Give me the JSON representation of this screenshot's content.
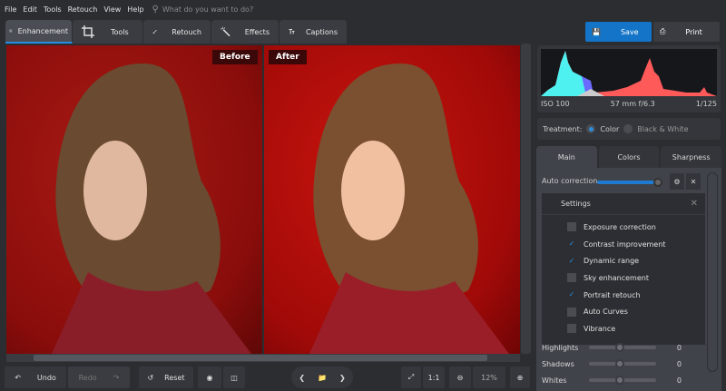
{
  "menu": [
    "File",
    "Edit",
    "Tools",
    "Retouch",
    "View",
    "Help"
  ],
  "search": {
    "placeholder": "What do you want to do?"
  },
  "tabs": [
    {
      "label": "Enhancement",
      "icon": "sliders-icon"
    },
    {
      "label": "Tools",
      "icon": "crop-icon"
    },
    {
      "label": "Retouch",
      "icon": "brush-icon"
    },
    {
      "label": "Effects",
      "icon": "magic-wand-icon"
    },
    {
      "label": "Captions",
      "icon": "text-icon"
    }
  ],
  "actions": {
    "save": "Save",
    "print": "Print"
  },
  "photo": {
    "before": "Before",
    "after": "After"
  },
  "exif": {
    "iso": "ISO 100",
    "lens": "57 mm f/6.3",
    "shutter": "1/125"
  },
  "treatment": {
    "label": "Treatment:",
    "options": [
      "Color",
      "Black & White"
    ],
    "selected": "Color"
  },
  "panel_tabs": [
    "Main",
    "Colors",
    "Sharpness"
  ],
  "auto_correction": {
    "label": "Auto correction",
    "value": 100
  },
  "settings": {
    "title": "Settings",
    "items": [
      {
        "label": "Exposure correction",
        "checked": false
      },
      {
        "label": "Contrast improvement",
        "checked": true
      },
      {
        "label": "Dynamic range",
        "checked": true
      },
      {
        "label": "Sky enhancement",
        "checked": false
      },
      {
        "label": "Portrait retouch",
        "checked": true
      },
      {
        "label": "Auto Curves",
        "checked": false
      },
      {
        "label": "Vibrance",
        "checked": false
      }
    ]
  },
  "sliders": [
    {
      "label": "Highlights",
      "value": "0"
    },
    {
      "label": "Shadows",
      "value": "0"
    },
    {
      "label": "Whites",
      "value": "0"
    }
  ],
  "bottom": {
    "undo": "Undo",
    "redo": "Redo",
    "reset": "Reset",
    "ratio": "1:1",
    "zoom": "12%"
  },
  "colors": {
    "accent": "#2a8ee0",
    "photo_bg": "#a80d0d"
  }
}
